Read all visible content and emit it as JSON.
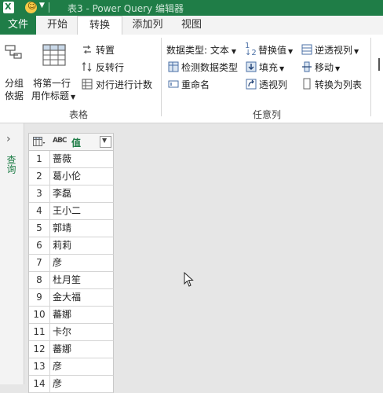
{
  "window": {
    "title": "表3 - Power Query 编辑器",
    "excel_letter": "X"
  },
  "tabs": [
    {
      "label": "文件"
    },
    {
      "label": "开始"
    },
    {
      "label": "转换"
    },
    {
      "label": "添加列"
    },
    {
      "label": "视图"
    }
  ],
  "ribbon": {
    "table_group": {
      "label": "表格",
      "group_by": {
        "line1": "分组",
        "line2": "依据"
      },
      "first_row_header": {
        "line1": "将第一行",
        "line2": "用作标题"
      },
      "transpose": "转置",
      "reverse_rows": "反转行",
      "count_rows": "对行进行计数"
    },
    "any_column_group": {
      "label": "任意列",
      "data_type": "数据类型: 文本",
      "detect_type": "检测数据类型",
      "rename": "重命名",
      "replace_values": "替换值",
      "fill": "填充",
      "pivot": "透视列",
      "unpivot": "逆透视列",
      "move": "移动",
      "to_list": "转换为列表"
    }
  },
  "nav": {
    "query_label": "查询"
  },
  "grid": {
    "column_type": "ABC",
    "column_name": "值",
    "rows": [
      {
        "n": "1",
        "v": "蔷薇"
      },
      {
        "n": "2",
        "v": "葛小伦"
      },
      {
        "n": "3",
        "v": "李磊"
      },
      {
        "n": "4",
        "v": "王小二"
      },
      {
        "n": "5",
        "v": "郭靖"
      },
      {
        "n": "6",
        "v": "莉莉"
      },
      {
        "n": "7",
        "v": "彦"
      },
      {
        "n": "8",
        "v": "杜月笙"
      },
      {
        "n": "9",
        "v": "金大福"
      },
      {
        "n": "10",
        "v": "蕃娜"
      },
      {
        "n": "11",
        "v": "卡尔"
      },
      {
        "n": "12",
        "v": "蕃娜"
      },
      {
        "n": "13",
        "v": "彦"
      },
      {
        "n": "14",
        "v": "彦"
      }
    ]
  },
  "colors": {
    "accent": "#1f7d47"
  }
}
